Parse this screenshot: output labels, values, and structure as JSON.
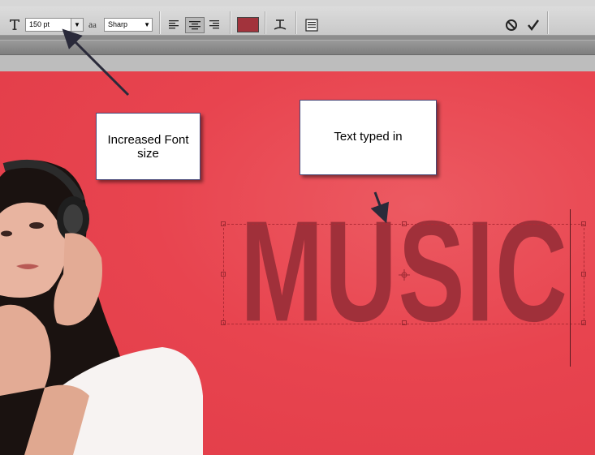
{
  "options_bar": {
    "font_size": {
      "value": "150 pt",
      "icon": "type-tool-icon"
    },
    "antialias": {
      "label": "aa",
      "value": "Sharp"
    },
    "alignment": {
      "options": [
        "left",
        "center",
        "right"
      ],
      "active": "center"
    },
    "text_color": "#a2333c",
    "cancel_icon": "cancel-icon",
    "commit_icon": "commit-checkmark-icon"
  },
  "canvas": {
    "text_layer": {
      "content": "MUSIC",
      "color": "#a0303a"
    }
  },
  "annotations": {
    "font_callout": {
      "text": "Increased Font size"
    },
    "text_callout": {
      "text": "Text typed in"
    }
  },
  "colors": {
    "background_red": "#e9414c",
    "toolbar_gray": "#d2d2d2"
  }
}
